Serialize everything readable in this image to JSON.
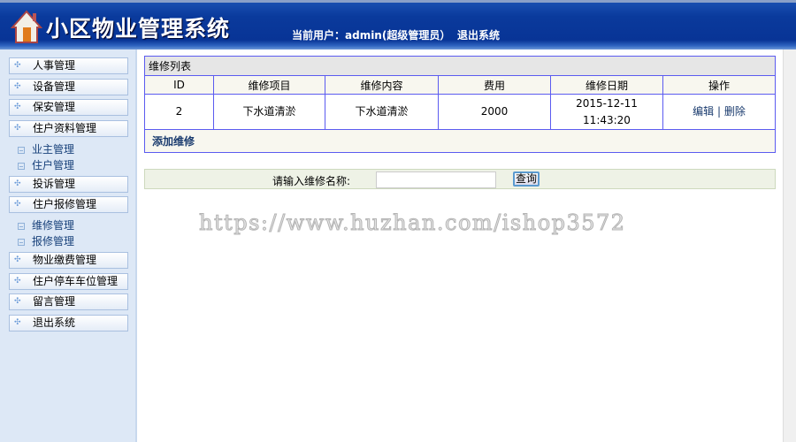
{
  "header": {
    "title": "小区物业管理系统",
    "user": "当前用户：admin(超级管理员）",
    "logout": "退出系统"
  },
  "sidebar": {
    "menus": [
      "人事管理",
      "设备管理",
      "保安管理",
      "住户资料管理",
      "投诉管理",
      "住户报修管理",
      "物业缴费管理",
      "住户停车车位管理",
      "留言管理",
      "退出系统"
    ],
    "sub_resident": [
      "业主管理",
      "住户管理"
    ],
    "sub_repair": [
      "维修管理",
      "报修管理"
    ]
  },
  "table": {
    "caption": "维修列表",
    "headers": [
      "ID",
      "维修项目",
      "维修内容",
      "费用",
      "维修日期",
      "操作"
    ],
    "rows": [
      {
        "id": "2",
        "item": "下水道清淤",
        "content": "下水道清淤",
        "cost": "2000",
        "date": "2015-12-11",
        "time": "11:43:20",
        "edit": "编辑",
        "sep": "|",
        "delete": "删除"
      }
    ],
    "add": "添加维修"
  },
  "search": {
    "label": "请输入维修名称:",
    "value": "",
    "button": "查询"
  },
  "watermark": "https://www.huzhan.com/ishop3572"
}
